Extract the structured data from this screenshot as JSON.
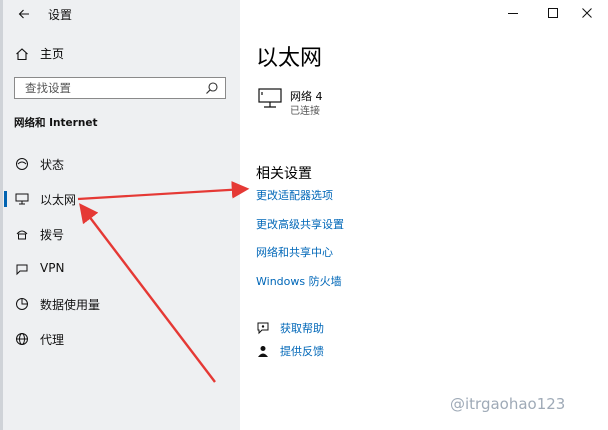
{
  "window": {
    "title": "设置"
  },
  "sidebar": {
    "home_label": "主页",
    "search_placeholder": "查找设置",
    "section_title": "网络和 Internet",
    "items": [
      {
        "label": "状态",
        "icon": "status-icon"
      },
      {
        "label": "以太网",
        "icon": "ethernet-icon",
        "selected": true
      },
      {
        "label": "拨号",
        "icon": "dialup-icon"
      },
      {
        "label": "VPN",
        "icon": "vpn-icon"
      },
      {
        "label": "数据使用量",
        "icon": "data-usage-icon"
      },
      {
        "label": "代理",
        "icon": "proxy-icon"
      }
    ]
  },
  "main": {
    "title": "以太网",
    "network": {
      "name": "网络 4",
      "status": "已连接"
    },
    "related_title": "相关设置",
    "links": [
      "更改适配器选项",
      "更改高级共享设置",
      "网络和共享中心",
      "Windows 防火墙"
    ],
    "help": [
      {
        "label": "获取帮助",
        "icon": "get-help-icon"
      },
      {
        "label": "提供反馈",
        "icon": "feedback-icon"
      }
    ]
  },
  "watermark": "@itrgaohao123",
  "colors": {
    "accent": "#0067b8",
    "sidebar_bg": "#eef0f2",
    "annotation_arrow": "#e53935"
  }
}
